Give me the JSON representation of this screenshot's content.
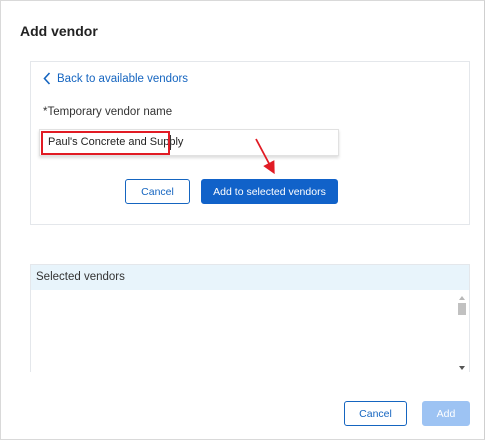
{
  "dialog": {
    "title": "Add vendor"
  },
  "entry_card": {
    "back_link_label": "Back to available vendors",
    "field_label": "*Temporary vendor name",
    "input_value": "Paul's Concrete and Supply",
    "cancel_label": "Cancel",
    "add_selected_label": "Add to selected vendors"
  },
  "selected_panel": {
    "header": "Selected vendors"
  },
  "footer": {
    "cancel_label": "Cancel",
    "add_label": "Add"
  },
  "colors": {
    "accent": "#1162c9",
    "link": "#1565c0",
    "highlight": "#e11b24",
    "panel_header_bg": "#e8f4fb",
    "disabled_button": "#9dc3f3"
  }
}
